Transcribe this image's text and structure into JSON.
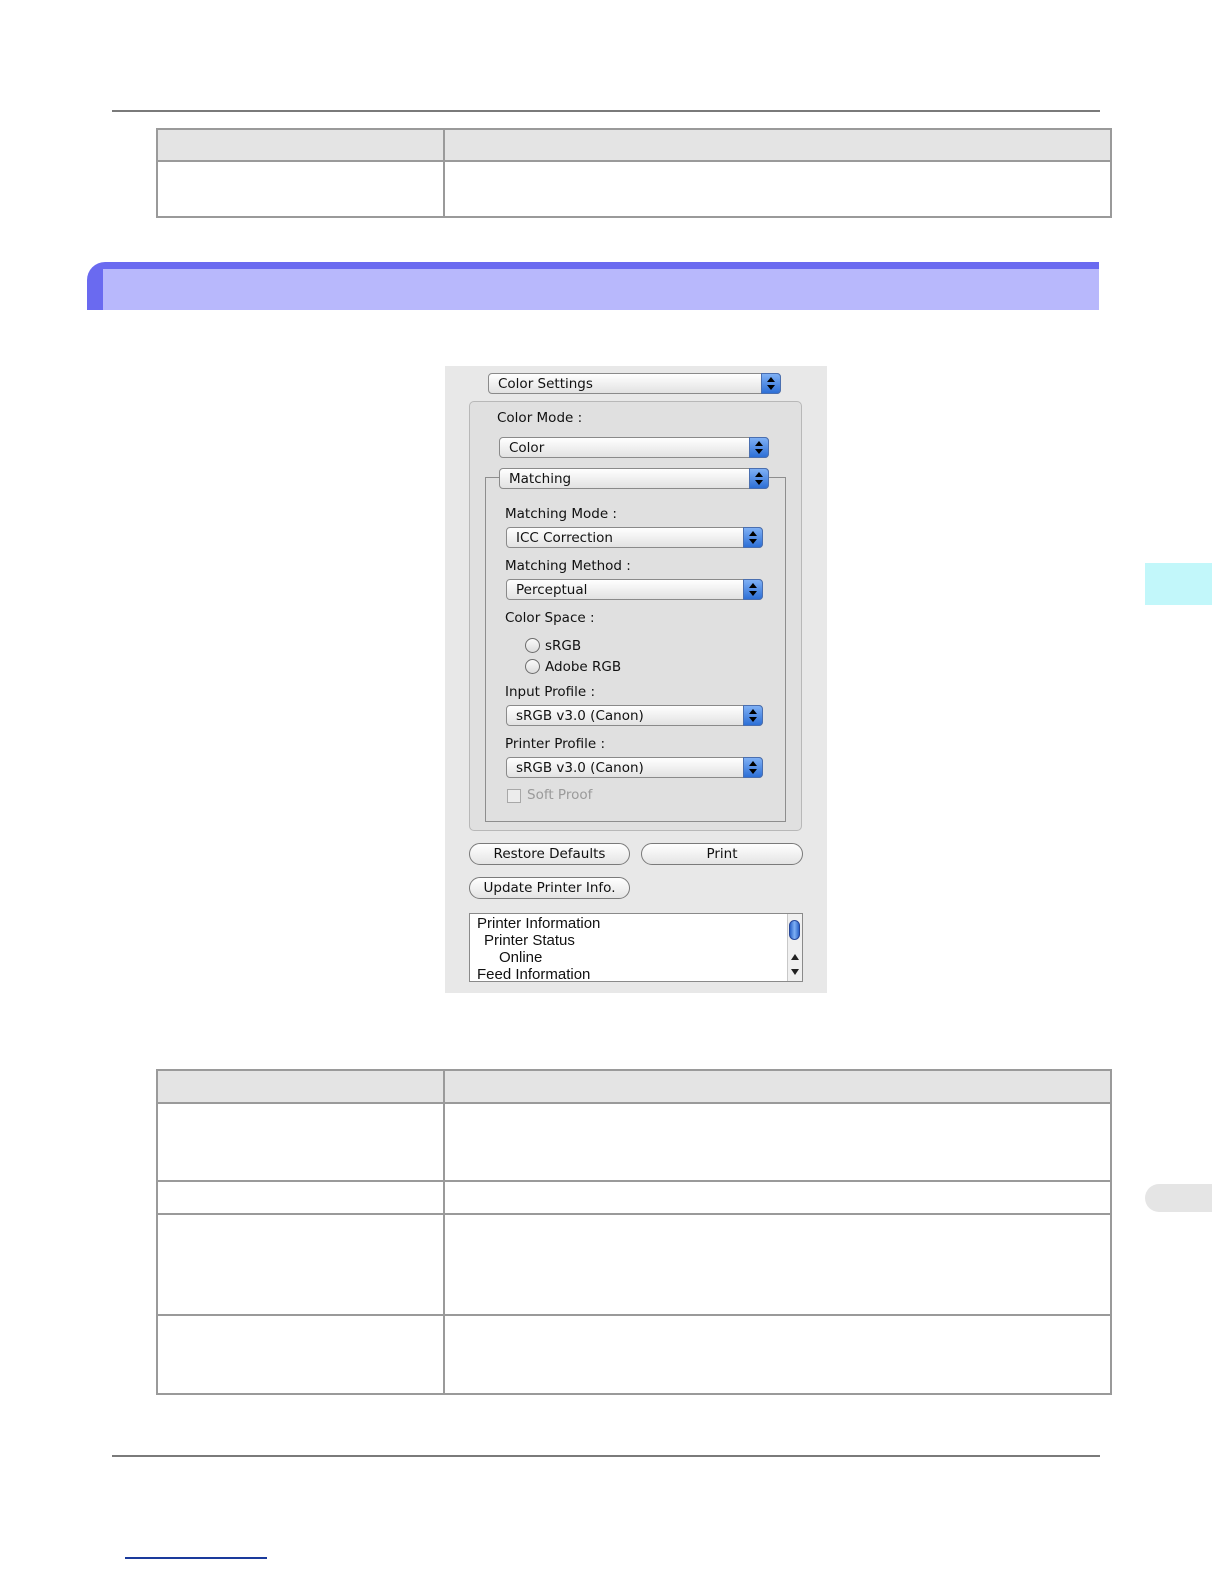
{
  "dialog": {
    "panel_popup": "Color Settings",
    "color_mode_label": "Color Mode :",
    "color_mode_value": "Color",
    "matching_popup": "Matching",
    "matching_mode_label": "Matching Mode :",
    "matching_mode_value": "ICC Correction",
    "matching_method_label": "Matching Method :",
    "matching_method_value": "Perceptual",
    "color_space_label": "Color Space :",
    "color_space_options": [
      "sRGB",
      "Adobe RGB"
    ],
    "input_profile_label": "Input Profile :",
    "input_profile_value": "sRGB v3.0 (Canon)",
    "printer_profile_label": "Printer Profile :",
    "printer_profile_value": "sRGB v3.0 (Canon)",
    "soft_proof_label": "Soft Proof",
    "restore_defaults_label": "Restore Defaults",
    "print_label": "Print",
    "update_printer_info_label": "Update Printer Info.",
    "printer_info_list": [
      "Printer Information",
      "Printer Status",
      "Online",
      "Feed Information"
    ]
  },
  "colors": {
    "section_bar": "#6a6af0",
    "section_bar_inner": "#b8b8fc",
    "table_header": "#e4e4e4",
    "side_tab": "#c2f7fa",
    "popup_arrows": "#2d6fd6"
  }
}
